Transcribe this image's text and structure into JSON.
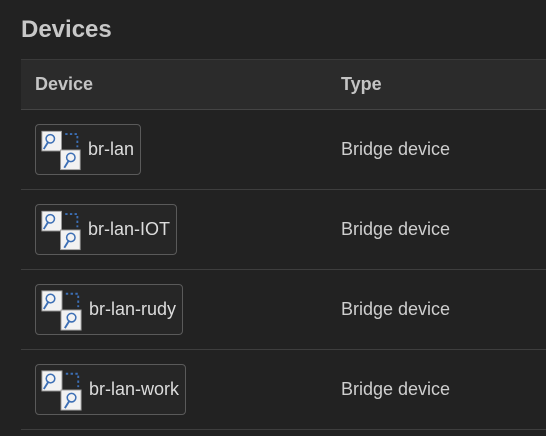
{
  "page": {
    "title": "Devices"
  },
  "table": {
    "headers": {
      "device": "Device",
      "type": "Type"
    },
    "rows": [
      {
        "name": "br-lan",
        "type": "Bridge device",
        "icon": "bridge-icon"
      },
      {
        "name": "br-lan-IOT",
        "type": "Bridge device",
        "icon": "bridge-icon"
      },
      {
        "name": "br-lan-rudy",
        "type": "Bridge device",
        "icon": "bridge-icon"
      },
      {
        "name": "br-lan-work",
        "type": "Bridge device",
        "icon": "bridge-icon"
      }
    ]
  }
}
